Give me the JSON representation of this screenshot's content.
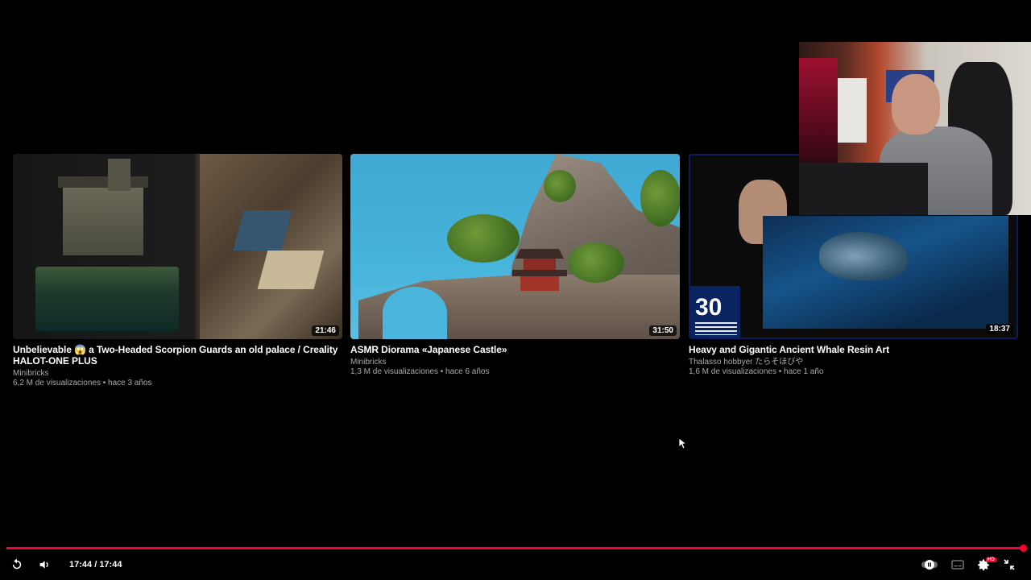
{
  "end_screen": {
    "cards": [
      {
        "title": "Unbelievable 😱 a Two-Headed Scorpion Guards an old palace / Creality HALOT-ONE PLUS",
        "channel": "Minibricks",
        "meta": "6,2 M de visualizaciones • hace 3 años",
        "duration": "21:46"
      },
      {
        "title": "ASMR Diorama «Japanese Castle»",
        "channel": "Minibricks",
        "meta": "1,3 M de visualizaciones • hace 6 años",
        "duration": "31:50"
      },
      {
        "title": "Heavy and Gigantic Ancient Whale Resin Art",
        "channel": "Thalasso hobbyer たらそほびや",
        "meta": "1,6 M de visualizaciones • hace 1 año",
        "duration": "18:37",
        "badge": "30"
      }
    ]
  },
  "player": {
    "time_current": "17:44",
    "time_separator": " / ",
    "time_total": "17:44",
    "progress": 1.0,
    "hd_badge": "HD",
    "accent_color": "#ff0033",
    "icons": {
      "replay": "replay-icon",
      "volume": "volume-icon",
      "autoplay": "autoplay-toggle-icon",
      "subtitles": "subtitles-icon",
      "settings": "settings-gear-icon",
      "exit_fullscreen": "exit-fullscreen-icon"
    }
  }
}
